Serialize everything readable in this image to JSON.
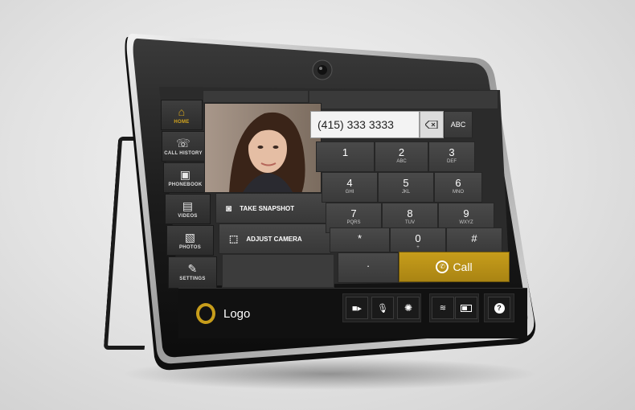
{
  "device": {
    "frame_color": "#1b1b1b",
    "accent_color": "#c79d1b"
  },
  "nav": {
    "items": [
      {
        "id": "home",
        "label": "HOME",
        "icon": "home-icon",
        "active": true
      },
      {
        "id": "call-history",
        "label": "CALL HISTORY",
        "icon": "call-history-icon",
        "active": false
      },
      {
        "id": "phonebook",
        "label": "PHONEBOOK",
        "icon": "phonebook-icon",
        "active": false
      },
      {
        "id": "videos",
        "label": "VIDEOS",
        "icon": "videos-icon",
        "active": false
      },
      {
        "id": "photos",
        "label": "PHOTOS",
        "icon": "photos-icon",
        "active": false
      },
      {
        "id": "settings",
        "label": "SETTINGS",
        "icon": "settings-icon",
        "active": false
      }
    ]
  },
  "dialer": {
    "number": "(415) 333 3333",
    "mode_label": "ABC",
    "backspace_icon": "backspace-icon",
    "keys": [
      {
        "digit": "1",
        "letters": ""
      },
      {
        "digit": "2",
        "letters": "ABC"
      },
      {
        "digit": "3",
        "letters": "DEF"
      },
      {
        "digit": "4",
        "letters": "GHI"
      },
      {
        "digit": "5",
        "letters": "JKL"
      },
      {
        "digit": "6",
        "letters": "MNO"
      },
      {
        "digit": "7",
        "letters": "PQRS"
      },
      {
        "digit": "8",
        "letters": "TUV"
      },
      {
        "digit": "9",
        "letters": "WXYZ"
      },
      {
        "digit": "*",
        "letters": ""
      },
      {
        "digit": "0",
        "letters": "+"
      },
      {
        "digit": "#",
        "letters": ""
      }
    ],
    "dot_key": ".",
    "call_label": "Call"
  },
  "actions": {
    "snapshot_label": "TAKE SNAPSHOT",
    "adjust_camera_label": "ADJUST CAMERA"
  },
  "bottom": {
    "logo_text": "Logo",
    "toolbar_icons": [
      "video-camera-icon",
      "microphone-icon",
      "loading-spinner-icon",
      "wifi-icon",
      "battery-icon",
      "help-icon"
    ]
  }
}
